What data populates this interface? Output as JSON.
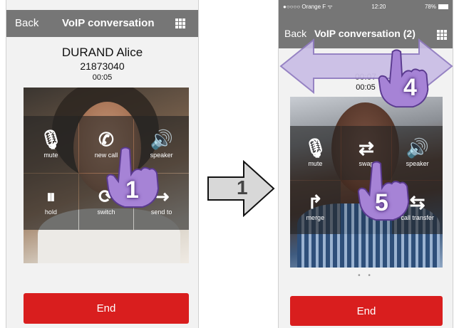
{
  "left_screen": {
    "nav": {
      "back": "Back",
      "title": "VoIP conversation"
    },
    "caller": {
      "name": "DURAND Alice",
      "number": "21873040",
      "duration": "00:05"
    },
    "keys": [
      {
        "icon": "mic-off-icon",
        "glyph": "🎙",
        "label": "mute"
      },
      {
        "icon": "phone-plus-icon",
        "glyph": "✆",
        "label": "new call"
      },
      {
        "icon": "speaker-icon",
        "glyph": "🔊",
        "label": "speaker"
      },
      {
        "icon": "pause-icon",
        "glyph": "⏸",
        "label": "hold"
      },
      {
        "icon": "switch-icon",
        "glyph": "⟳",
        "label": "switch"
      },
      {
        "icon": "send-to-icon",
        "glyph": "↪",
        "label": "send to"
      }
    ],
    "end_label": "End"
  },
  "right_screen": {
    "status": {
      "carrier": "●○○○○ Orange F ᯤ",
      "time": "12:20",
      "battery": "78%"
    },
    "nav": {
      "back": "Back",
      "title": "VoIP conversation (2)"
    },
    "caller": {
      "number": "00:07",
      "duration": "00:05"
    },
    "keys": [
      {
        "icon": "mic-off-icon",
        "glyph": "🎙",
        "label": "mute"
      },
      {
        "icon": "swap-icon",
        "glyph": "⇄",
        "label": "swap"
      },
      {
        "icon": "speaker-icon",
        "glyph": "🔊",
        "label": "speaker"
      },
      {
        "icon": "merge-icon",
        "glyph": "↱",
        "label": "merge"
      },
      {
        "icon": "blank",
        "glyph": "",
        "label": ""
      },
      {
        "icon": "call-transfer-icon",
        "glyph": "⇆",
        "label": "call transfer"
      }
    ],
    "page_dots": "• •",
    "end_label": "End"
  },
  "annotations": {
    "step1_hand": "1",
    "flow_arrow": "1",
    "step4_hand": "4",
    "step5_hand": "5"
  },
  "colors": {
    "navbar": "#767676",
    "end_button": "#d91e1e",
    "hand_annotation": "#a683d6",
    "swipe_arrow": "#c9bde6"
  }
}
